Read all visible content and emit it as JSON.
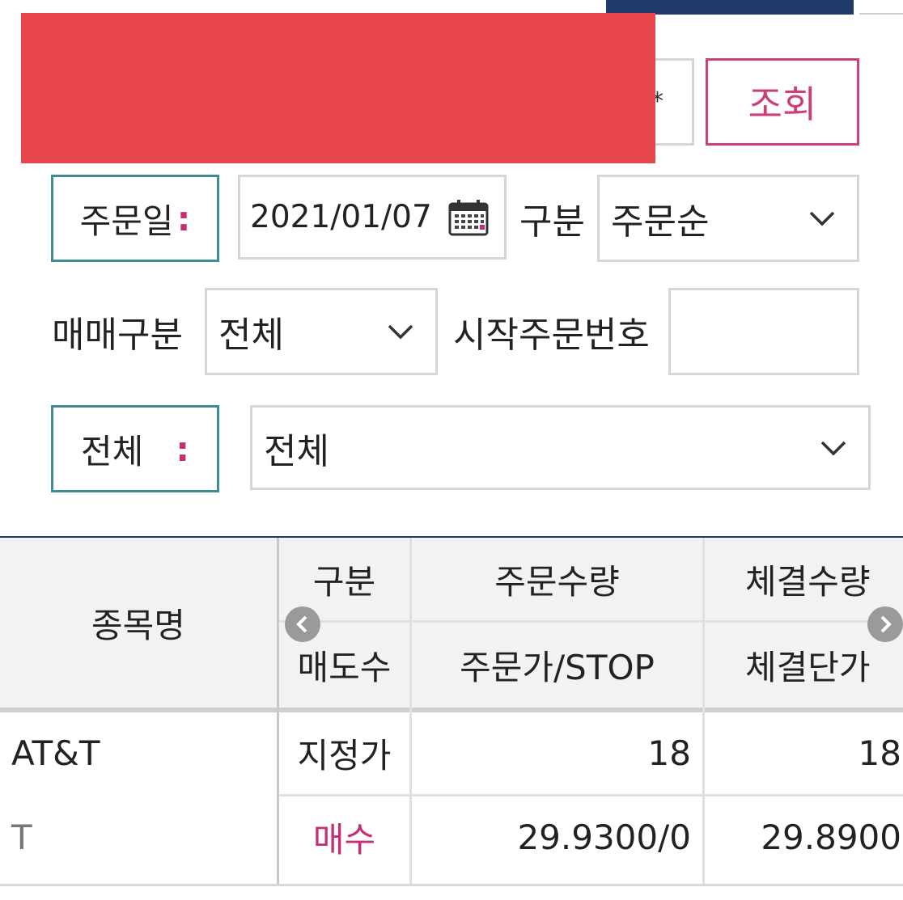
{
  "account": {
    "mask_char": "*"
  },
  "search_button": {
    "label": "조회"
  },
  "order_date": {
    "tag_label": "주문일",
    "tag_colon": ":",
    "value": "2021/01/07"
  },
  "sort": {
    "label": "구분",
    "selected": "주문순"
  },
  "trade_type": {
    "label": "매매구분",
    "selected": "전체"
  },
  "start_order_no": {
    "label": "시작주문번호",
    "value": ""
  },
  "filter": {
    "tag_label": "전체",
    "tag_colon": ":",
    "selected": "전체"
  },
  "table": {
    "headers": {
      "name": "종목명",
      "type_top": "구분",
      "type_bottom": "매도수",
      "order_qty": "주문수량",
      "order_price": "주문가/STOP",
      "fill_qty": "체결수량",
      "fill_price": "체결단가"
    },
    "rows": [
      {
        "name": "AT&T",
        "ticker": "T",
        "order_type": "지정가",
        "side": "매수",
        "order_qty": "18",
        "order_price": "29.9300/0",
        "fill_qty": "18",
        "fill_price": "29.8900"
      }
    ]
  },
  "colors": {
    "accent_pink": "#cc3f7d",
    "teal_border": "#3a8e91",
    "navy": "#1f3a6b",
    "redaction": "#e8484d"
  }
}
